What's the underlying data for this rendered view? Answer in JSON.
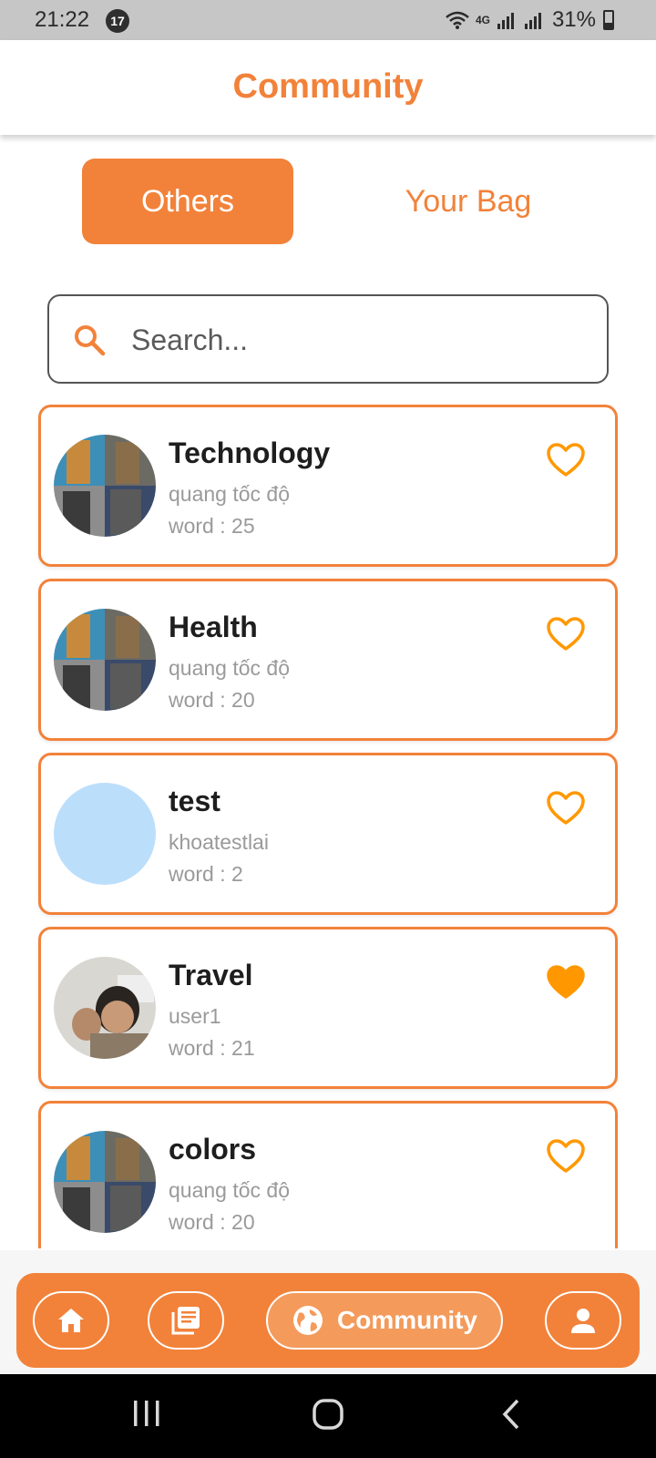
{
  "status_bar": {
    "time": "21:22",
    "notification_count": "17",
    "network": "4G",
    "battery": "31%"
  },
  "header": {
    "title": "Community"
  },
  "tabs": [
    {
      "label": "Others",
      "active": true
    },
    {
      "label": "Your Bag",
      "active": false
    }
  ],
  "search": {
    "placeholder": "Search...",
    "value": ""
  },
  "collections": [
    {
      "title": "Technology",
      "author": "quang tốc độ",
      "words": "word : 25",
      "favorited": false,
      "avatar": "collage"
    },
    {
      "title": "Health",
      "author": "quang tốc độ",
      "words": "word : 20",
      "favorited": false,
      "avatar": "collage"
    },
    {
      "title": "test",
      "author": "khoatestlai",
      "words": "word : 2",
      "favorited": false,
      "avatar": "blank"
    },
    {
      "title": "Travel",
      "author": "user1",
      "words": "word : 21",
      "favorited": true,
      "avatar": "photo"
    },
    {
      "title": "colors",
      "author": "quang tốc độ",
      "words": "word : 20",
      "favorited": false,
      "avatar": "collage"
    }
  ],
  "bottom_nav": {
    "items": [
      {
        "icon": "home-icon",
        "label": ""
      },
      {
        "icon": "library-icon",
        "label": ""
      },
      {
        "icon": "globe-icon",
        "label": "Community",
        "active": true
      },
      {
        "icon": "person-icon",
        "label": ""
      }
    ]
  },
  "colors": {
    "accent": "#f2823a",
    "heart": "#ff9800",
    "placeholder_avatar": "#bbdefb"
  }
}
